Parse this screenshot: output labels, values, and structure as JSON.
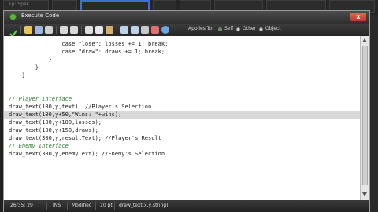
{
  "background": {
    "panel_text": "Tp: Spec...",
    "accent": "#3b6fd6"
  },
  "window": {
    "title": "Execute Code",
    "close_symbol": "x"
  },
  "toolbar": {
    "applies_to_label": "Applies To:",
    "options": [
      "Self",
      "Other",
      "Object"
    ],
    "selected_option": "Self"
  },
  "editor": {
    "highlighted_line_index": 7,
    "lines": [
      {
        "text": "                case \"lose\": losses += 1; break;",
        "color": "#1a1a1a",
        "italic": false
      },
      {
        "text": "                case \"draw\": draws += 1; break;",
        "color": "#1a1a1a",
        "italic": false
      },
      {
        "text": "            }",
        "color": "#1a1a1a",
        "italic": false
      },
      {
        "text": "        }",
        "color": "#1a1a1a",
        "italic": false
      },
      {
        "text": "    }",
        "color": "#1a1a1a",
        "italic": false
      },
      {
        "text": "// Player Interface",
        "color": "#2f7d2f",
        "italic": true
      },
      {
        "text": "draw_text(100,y,text); //Player's Selection",
        "color": "#1a1a1a",
        "italic": false
      },
      {
        "text": "draw_text(100,y+50,\"Wins: \"+wins);",
        "color": "#1a1a1a",
        "italic": false
      },
      {
        "text": "draw_text(100,y+100,losses);",
        "color": "#1a1a1a",
        "italic": false
      },
      {
        "text": "draw_text(100,y+150,draws);",
        "color": "#1a1a1a",
        "italic": false
      },
      {
        "text": "draw_text(300,y,resultText); //Player's Result",
        "color": "#1a1a1a",
        "italic": false
      },
      {
        "text": "// Enemy Interface",
        "color": "#2f7d2f",
        "italic": true
      },
      {
        "text": "draw_text(300,y,enemyText); //Enemy's Selection",
        "color": "#1a1a1a",
        "italic": false
      }
    ]
  },
  "status": {
    "cursor": "26/35: 29",
    "mode": "INS",
    "modified": "Modified",
    "font_size": "10 pt",
    "signature": "draw_text(x,y,string)"
  },
  "icons": {
    "title": "game-maker-icon",
    "toolbar": [
      "check-icon",
      "open-icon",
      "save-icon",
      "print-icon",
      "undo-icon",
      "redo-icon",
      "cut-icon",
      "copy-icon",
      "paste-icon",
      "find-icon",
      "replace-icon",
      "goto-icon",
      "color-icon",
      "help-icon"
    ]
  }
}
